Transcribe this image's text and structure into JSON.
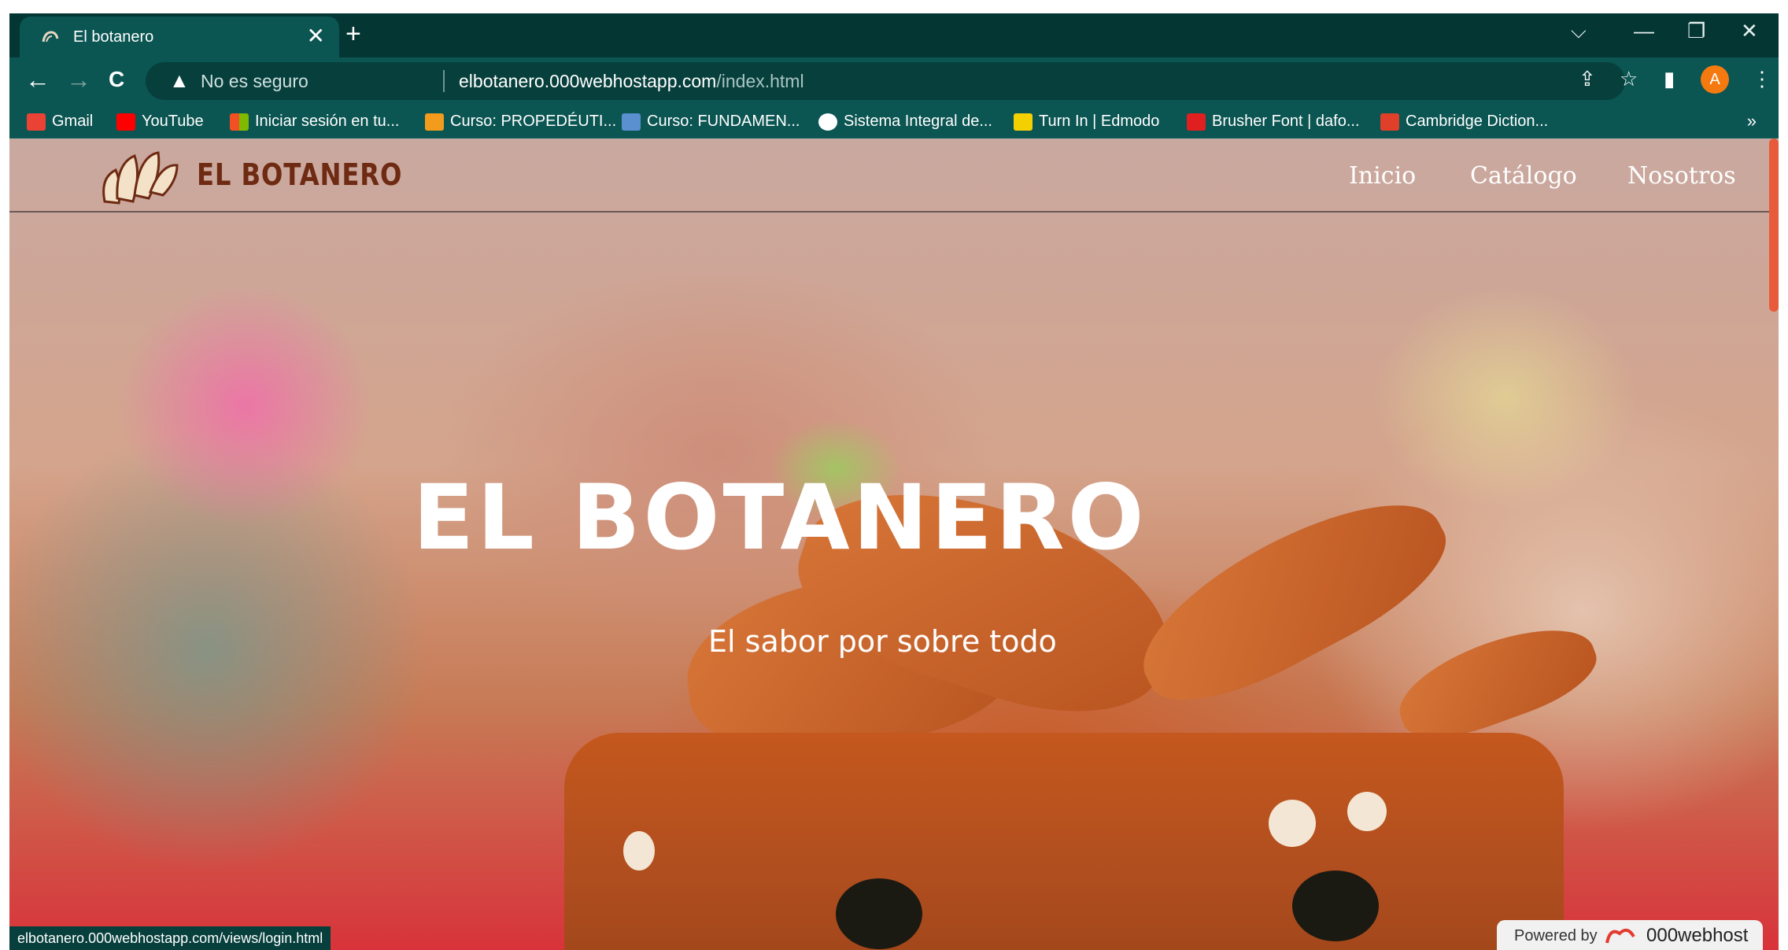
{
  "tab": {
    "title": "El botanero",
    "close": "✕",
    "new": "+"
  },
  "window_controls": {
    "dropdown": "⌵",
    "minimize": "—",
    "restore": "❐",
    "close": "✕"
  },
  "toolbar": {
    "back": "←",
    "forward": "→",
    "reload": "C",
    "security_label": "No es seguro",
    "url_domain": "elbotanero.000webhostapp.com",
    "url_path": "/index.html",
    "avatar_letter": "A"
  },
  "bookmarks": [
    {
      "label": "Gmail",
      "icon": "gmail-icon",
      "color": "#ea4335"
    },
    {
      "label": "YouTube",
      "icon": "youtube-icon",
      "color": "#ff0000"
    },
    {
      "label": "Iniciar sesión en tu...",
      "icon": "microsoft-icon",
      "color": "#f25022"
    },
    {
      "label": "Curso: PROPEDÉUTI...",
      "icon": "course-icon",
      "color": "#f29b1d"
    },
    {
      "label": "Curso: FUNDAMEN...",
      "icon": "course2-icon",
      "color": "#5a8fd0"
    },
    {
      "label": "Sistema Integral de...",
      "icon": "globe-icon",
      "color": "#ffffff"
    },
    {
      "label": "Turn In | Edmodo",
      "icon": "edmodo-icon",
      "color": "#f5d000"
    },
    {
      "label": "Brusher Font | dafo...",
      "icon": "dafont-icon",
      "color": "#e02020"
    },
    {
      "label": "Cambridge Diction...",
      "icon": "cambridge-icon",
      "color": "#e0402a"
    }
  ],
  "bookmarks_more": "»",
  "site": {
    "brand": "EL BOTANERO",
    "nav": [
      "Inicio",
      "Catálogo",
      "Nosotros"
    ],
    "hero_title": "EL BOTANERO",
    "hero_subtitle": "El sabor por sobre todo"
  },
  "status_bar_url": "elbotanero.000webhostapp.com/views/login.html",
  "powered": {
    "label": "Powered by",
    "brand": "000webhost"
  },
  "colors": {
    "chrome_dark": "#043633",
    "chrome": "#0b5552",
    "brand": "#6e2a12",
    "accent": "#f47a10"
  }
}
